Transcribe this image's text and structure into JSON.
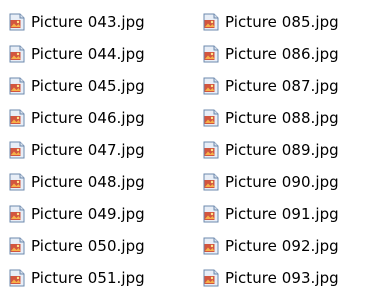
{
  "icon": "image-file-icon",
  "colors": {
    "text": "#000000",
    "background": "#ffffff",
    "icon_frame": "#6c89ad",
    "icon_paper": "#e8eef7",
    "icon_photo": "#d2553f"
  },
  "columns": [
    {
      "files": [
        "Picture 043.jpg",
        "Picture 044.jpg",
        "Picture 045.jpg",
        "Picture 046.jpg",
        "Picture 047.jpg",
        "Picture 048.jpg",
        "Picture 049.jpg",
        "Picture 050.jpg",
        "Picture 051.jpg"
      ]
    },
    {
      "files": [
        "Picture 085.jpg",
        "Picture 086.jpg",
        "Picture 087.jpg",
        "Picture 088.jpg",
        "Picture 089.jpg",
        "Picture 090.jpg",
        "Picture 091.jpg",
        "Picture 092.jpg",
        "Picture 093.jpg"
      ]
    }
  ]
}
